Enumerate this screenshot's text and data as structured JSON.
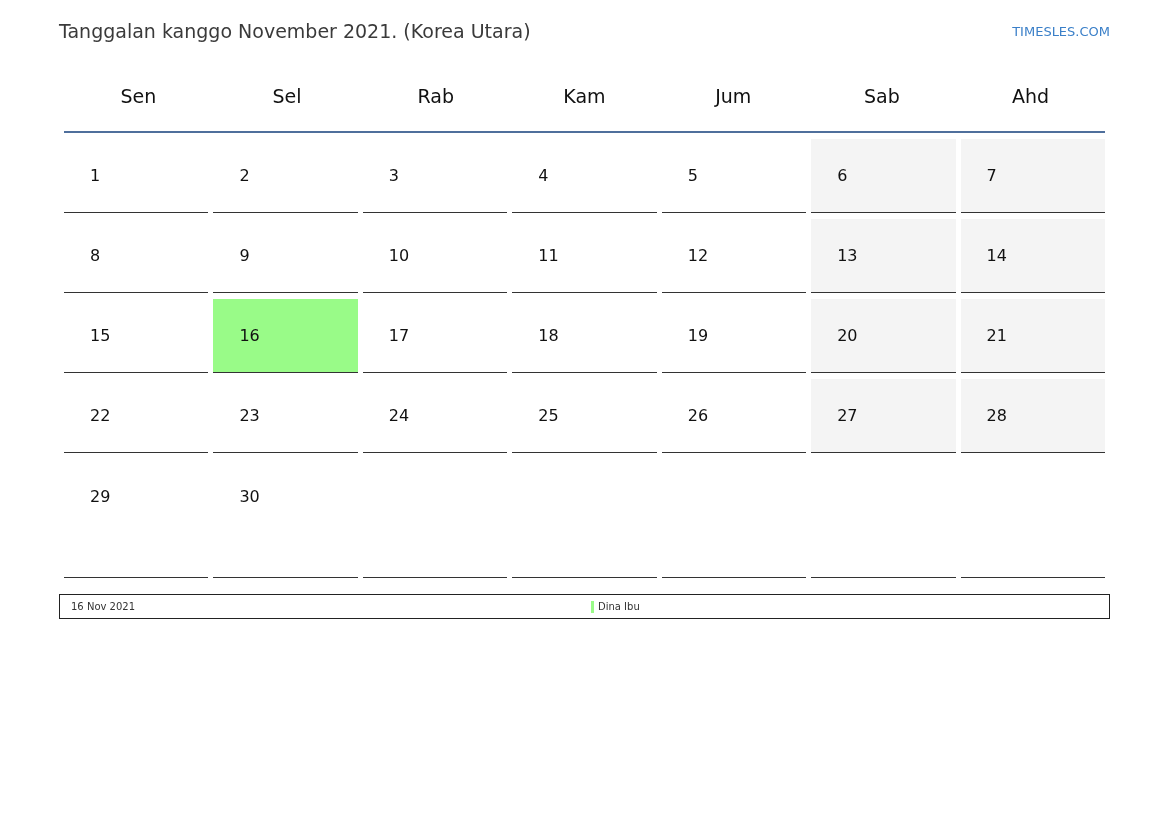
{
  "title": "Tanggalan kanggo November 2021. (Korea Utara)",
  "site_link": "TIMESLES.COM",
  "weekdays": [
    "Sen",
    "Sel",
    "Rab",
    "Kam",
    "Jum",
    "Sab",
    "Ahd"
  ],
  "weeks": [
    [
      {
        "day": "1",
        "kind": "workday"
      },
      {
        "day": "2",
        "kind": "workday"
      },
      {
        "day": "3",
        "kind": "workday"
      },
      {
        "day": "4",
        "kind": "workday"
      },
      {
        "day": "5",
        "kind": "workday"
      },
      {
        "day": "6",
        "kind": "weekend"
      },
      {
        "day": "7",
        "kind": "weekend"
      }
    ],
    [
      {
        "day": "8",
        "kind": "workday"
      },
      {
        "day": "9",
        "kind": "workday"
      },
      {
        "day": "10",
        "kind": "workday"
      },
      {
        "day": "11",
        "kind": "workday"
      },
      {
        "day": "12",
        "kind": "workday"
      },
      {
        "day": "13",
        "kind": "weekend"
      },
      {
        "day": "14",
        "kind": "weekend"
      }
    ],
    [
      {
        "day": "15",
        "kind": "workday"
      },
      {
        "day": "16",
        "kind": "holiday",
        "color": "#99fb88"
      },
      {
        "day": "17",
        "kind": "workday"
      },
      {
        "day": "18",
        "kind": "workday"
      },
      {
        "day": "19",
        "kind": "workday"
      },
      {
        "day": "20",
        "kind": "weekend"
      },
      {
        "day": "21",
        "kind": "weekend"
      }
    ],
    [
      {
        "day": "22",
        "kind": "workday"
      },
      {
        "day": "23",
        "kind": "workday"
      },
      {
        "day": "24",
        "kind": "workday"
      },
      {
        "day": "25",
        "kind": "workday"
      },
      {
        "day": "26",
        "kind": "workday"
      },
      {
        "day": "27",
        "kind": "weekend"
      },
      {
        "day": "28",
        "kind": "weekend"
      }
    ],
    [
      {
        "day": "29",
        "kind": "workday"
      },
      {
        "day": "30",
        "kind": "workday"
      }
    ]
  ],
  "holidays": [
    {
      "date": "16 Nov 2021",
      "name": "Dina Ibu",
      "color": "#99fb88"
    }
  ]
}
